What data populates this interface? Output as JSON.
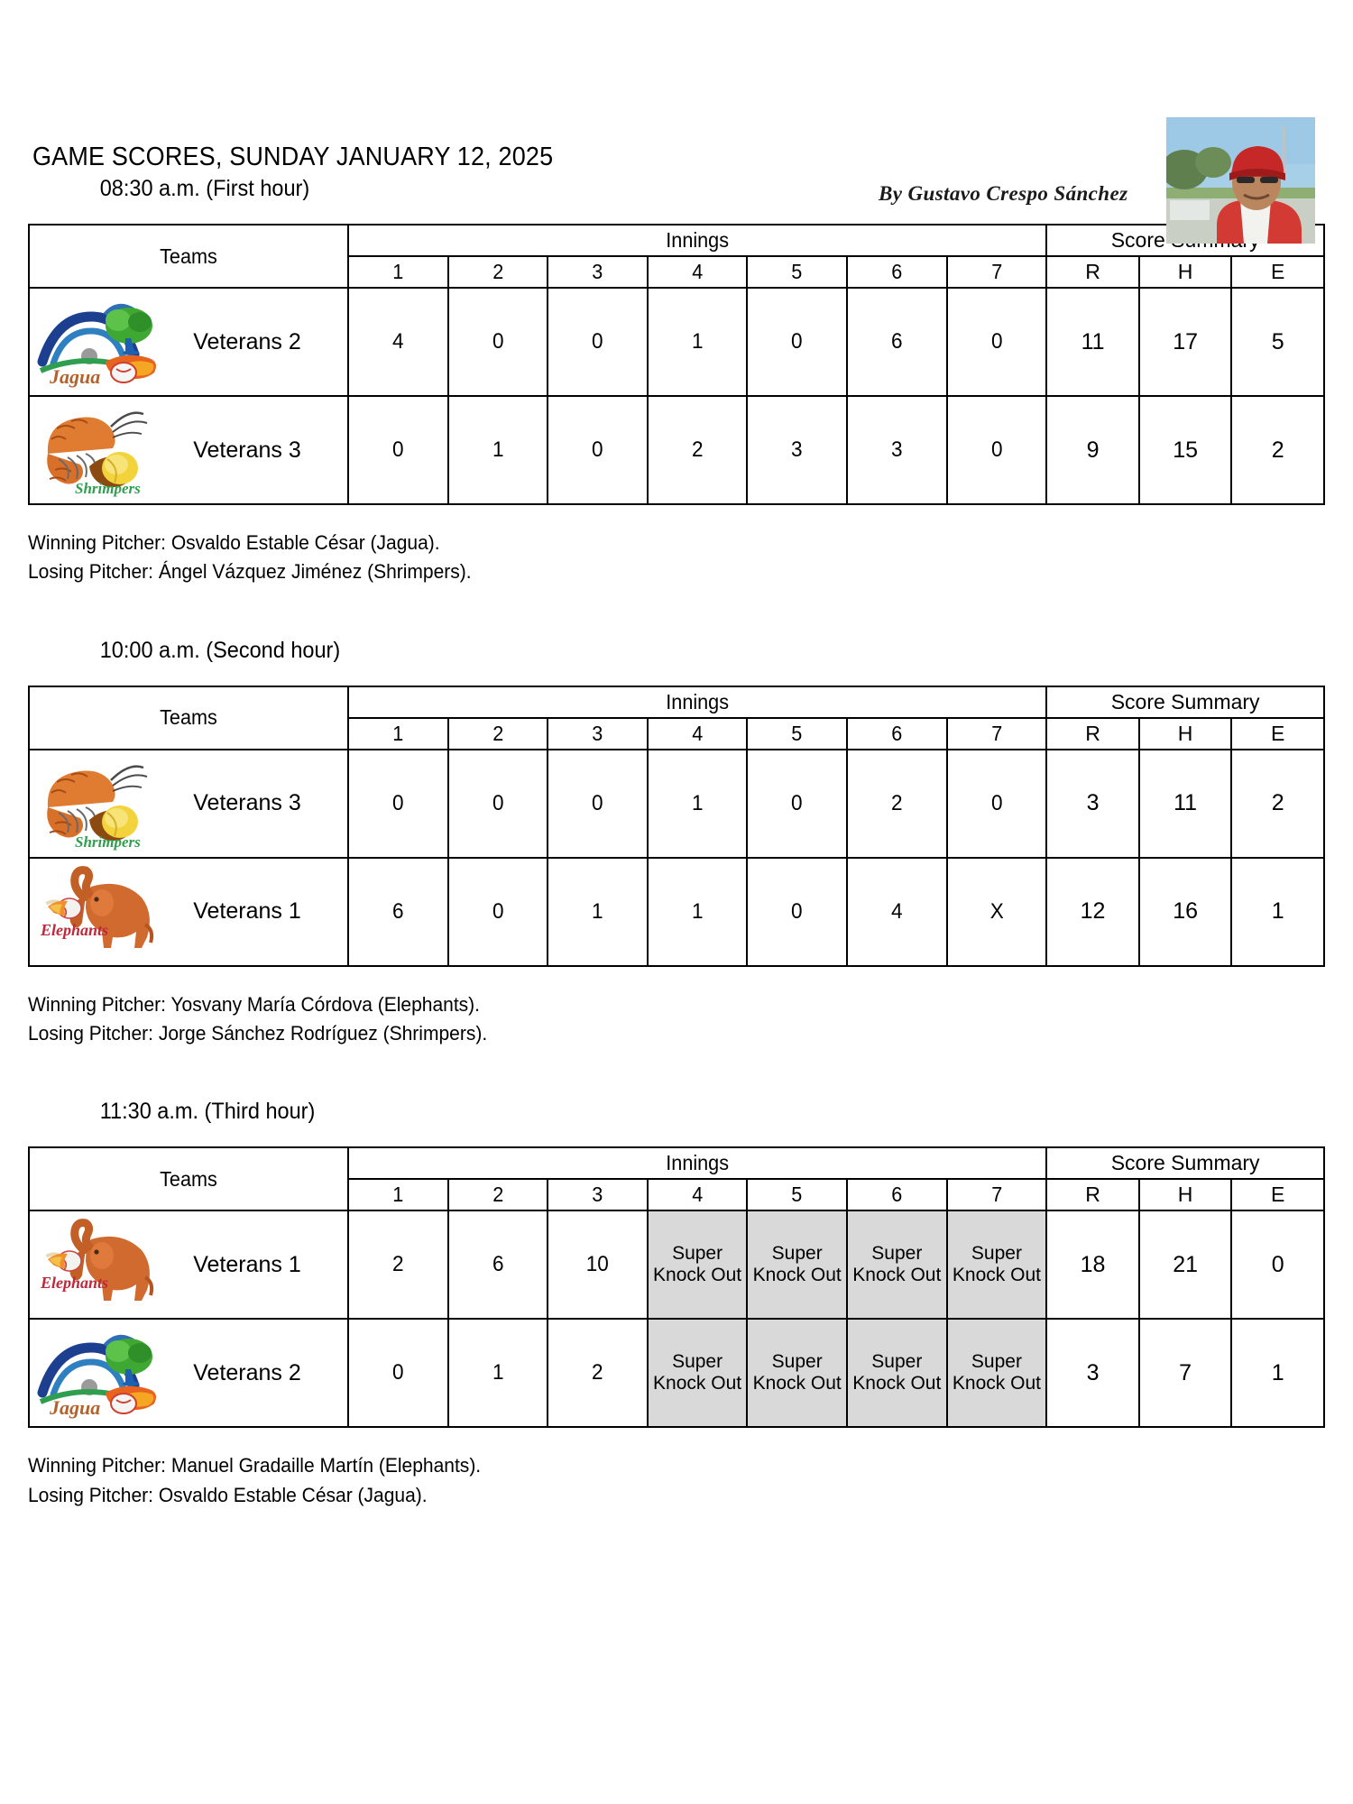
{
  "document": {
    "title": "GAME SCORES, SUNDAY JANUARY 12, 2025",
    "byline": "By Gustavo Crespo Sánchez"
  },
  "table_headers": {
    "teams": "Teams",
    "innings": "Innings",
    "score_summary": "Score Summary",
    "inning_numbers": [
      "1",
      "2",
      "3",
      "4",
      "5",
      "6",
      "7"
    ],
    "summary_columns": [
      "R",
      "H",
      "E"
    ]
  },
  "labels": {
    "winning_pitcher": "Winning Pitcher:",
    "losing_pitcher": "Losing Pitcher:"
  },
  "colors": {
    "knockout_cell_fill": "#d9d9d9",
    "border": "#000000",
    "page_background": "#ffffff"
  },
  "games": [
    {
      "time_heading": "08:30 a.m. (First hour)",
      "rows": [
        {
          "logo": "jagua-logo",
          "team": "Veterans 2",
          "innings": [
            "4",
            "0",
            "0",
            "1",
            "0",
            "6",
            "0"
          ],
          "r": "11",
          "h": "17",
          "e": "5"
        },
        {
          "logo": "shrimpers-logo",
          "team": "Veterans 3",
          "innings": [
            "0",
            "1",
            "0",
            "2",
            "3",
            "3",
            "0"
          ],
          "r": "9",
          "h": "15",
          "e": "2"
        }
      ],
      "winning_pitcher": "Osvaldo Estable César (Jagua).",
      "losing_pitcher": "Ángel Vázquez Jiménez (Shrimpers)."
    },
    {
      "time_heading": "10:00 a.m. (Second hour)",
      "rows": [
        {
          "logo": "shrimpers-logo",
          "team": "Veterans 3",
          "innings": [
            "0",
            "0",
            "0",
            "1",
            "0",
            "2",
            "0"
          ],
          "r": "3",
          "h": "11",
          "e": "2"
        },
        {
          "logo": "elephants-logo",
          "team": "Veterans 1",
          "innings": [
            "6",
            "0",
            "1",
            "1",
            "0",
            "4",
            "X"
          ],
          "r": "12",
          "h": "16",
          "e": "1"
        }
      ],
      "winning_pitcher": "Yosvany María Córdova (Elephants).",
      "losing_pitcher": "Jorge Sánchez Rodríguez (Shrimpers)."
    },
    {
      "time_heading": "11:30 a.m. (Third hour)",
      "rows": [
        {
          "logo": "elephants-logo",
          "team": "Veterans 1",
          "innings": [
            "2",
            "6",
            "10",
            "Super Knock Out",
            "Super Knock Out",
            "Super Knock Out",
            "Super Knock Out"
          ],
          "r": "18",
          "h": "21",
          "e": "0"
        },
        {
          "logo": "jagua-logo",
          "team": "Veterans 2",
          "innings": [
            "0",
            "1",
            "2",
            "Super Knock Out",
            "Super Knock Out",
            "Super Knock Out",
            "Super Knock Out"
          ],
          "r": "3",
          "h": "7",
          "e": "1"
        }
      ],
      "winning_pitcher": "Manuel Gradaille Martín (Elephants).",
      "losing_pitcher": "Osvaldo Estable César (Jagua)."
    }
  ]
}
